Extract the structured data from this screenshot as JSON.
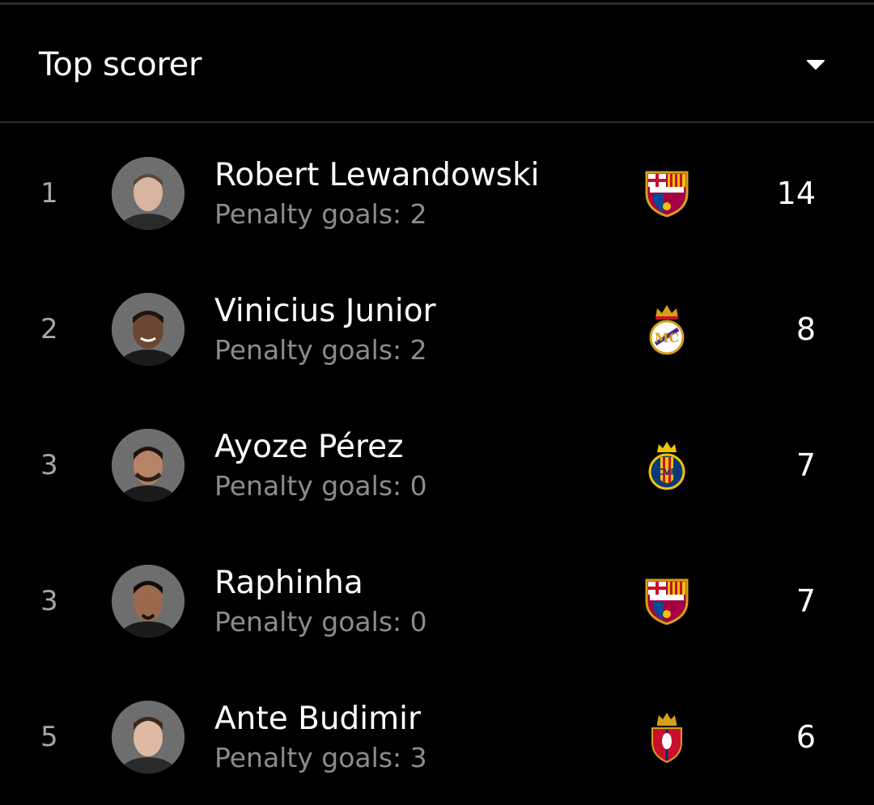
{
  "header": {
    "title": "Top scorer",
    "dropdown_icon": "caret-down-icon"
  },
  "players": [
    {
      "rank": "1",
      "name": "Robert Lewandowski",
      "penalty": "Penalty goals: 2",
      "club_crest": "fc-barcelona-crest",
      "goals": "14"
    },
    {
      "rank": "2",
      "name": "Vinicius Junior",
      "penalty": "Penalty goals: 2",
      "club_crest": "real-madrid-crest",
      "goals": "8"
    },
    {
      "rank": "3",
      "name": "Ayoze Pérez",
      "penalty": "Penalty goals: 0",
      "club_crest": "villarreal-crest",
      "goals": "7"
    },
    {
      "rank": "3",
      "name": "Raphinha",
      "penalty": "Penalty goals: 0",
      "club_crest": "fc-barcelona-crest",
      "goals": "7"
    },
    {
      "rank": "5",
      "name": "Ante Budimir",
      "penalty": "Penalty goals: 3",
      "club_crest": "osasuna-crest",
      "goals": "6"
    }
  ],
  "colors": {
    "background": "#000000",
    "primary_text": "#ffffff",
    "secondary_text": "#8c8c8c",
    "rank_text": "#a6a6a6",
    "divider": "#2e2e2e"
  }
}
